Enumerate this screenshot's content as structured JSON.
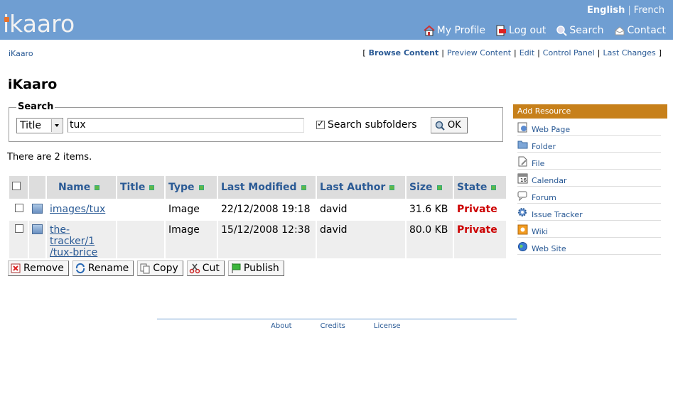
{
  "header": {
    "logo": "ikaaro",
    "languages": {
      "active": "English",
      "other": "French"
    },
    "nav": [
      "My Profile",
      "Log out",
      "Search",
      "Contact"
    ]
  },
  "breadcrumb": "iKaaro",
  "views": [
    "Browse Content",
    "Preview Content",
    "Edit",
    "Control Panel",
    "Last Changes"
  ],
  "page_title": "iKaaro",
  "search": {
    "legend": "Search",
    "field": "Title",
    "term": "tux",
    "subfolders_label": "Search subfolders",
    "ok": "OK"
  },
  "items_count": "There are 2 items.",
  "table": {
    "headers": [
      "Name",
      "Title",
      "Type",
      "Last Modified",
      "Last Author",
      "Size",
      "State"
    ],
    "rows": [
      {
        "name": "images/tux",
        "title": "",
        "type": "Image",
        "modified": "22/12/2008 19:18",
        "author": "david",
        "size": "31.6 KB",
        "state": "Private"
      },
      {
        "name_line1": "the-tracker/1",
        "name_line2": "/tux-brice",
        "title": "",
        "type": "Image",
        "modified": "15/12/2008 12:38",
        "author": "david",
        "size": "80.0 KB",
        "state": "Private"
      }
    ]
  },
  "actions": [
    "Remove",
    "Rename",
    "Copy",
    "Cut",
    "Publish"
  ],
  "add_resource": {
    "title": "Add Resource",
    "items": [
      "Web Page",
      "Folder",
      "File",
      "Calendar",
      "Forum",
      "Issue Tracker",
      "Wiki",
      "Web Site"
    ]
  },
  "footer": [
    "About",
    "Credits",
    "License"
  ]
}
